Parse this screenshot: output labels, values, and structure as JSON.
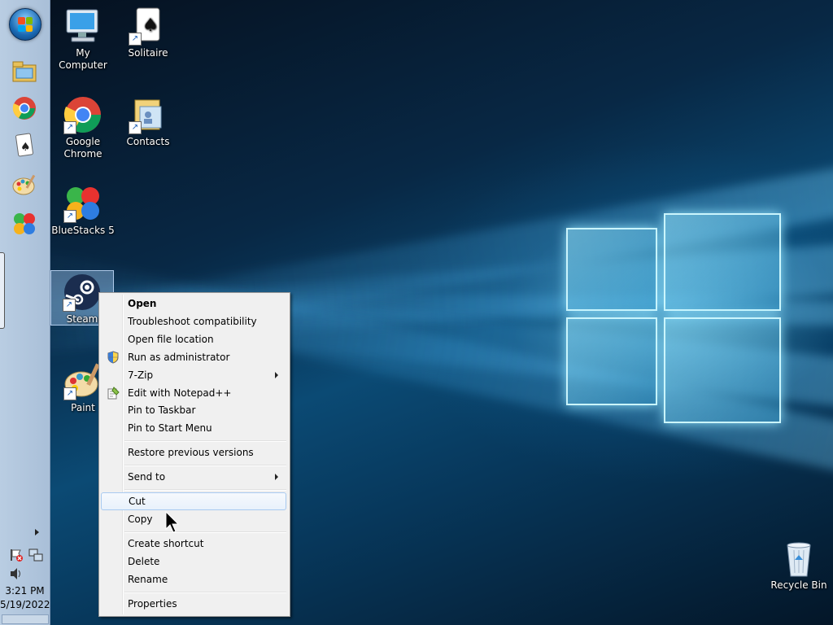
{
  "desktop": {
    "icons": [
      {
        "label": "My Computer",
        "icon": "my-computer-icon"
      },
      {
        "label": "Solitaire",
        "icon": "solitaire-icon"
      },
      {
        "label": "Google Chrome",
        "icon": "chrome-icon"
      },
      {
        "label": "Contacts",
        "icon": "contacts-icon"
      },
      {
        "label": "BlueStacks 5",
        "icon": "bluestacks-icon"
      },
      {
        "label": "Steam",
        "icon": "steam-icon",
        "selected": true
      },
      {
        "label": "Paint",
        "icon": "paint-icon"
      },
      {
        "label": "Recycle Bin",
        "icon": "recycle-bin-icon"
      }
    ]
  },
  "taskbar": {
    "pinned": [
      "start-orb-icon",
      "file-explorer-icon",
      "chrome-icon",
      "solitaire-icon",
      "paint-icon",
      "bluestacks-icon"
    ],
    "tray": {
      "time": "3:21 PM",
      "date": "5/19/2022"
    }
  },
  "context_menu": {
    "items": [
      {
        "label": "Open",
        "bold": true
      },
      {
        "label": "Troubleshoot compatibility"
      },
      {
        "label": "Open file location"
      },
      {
        "label": "Run as administrator",
        "icon": "uac-shield-icon"
      },
      {
        "label": "7-Zip",
        "submenu": true
      },
      {
        "label": "Edit with Notepad++",
        "icon": "notepad-plus-plus-icon"
      },
      {
        "label": "Pin to Taskbar"
      },
      {
        "label": "Pin to Start Menu"
      },
      {
        "label": "Restore previous versions"
      },
      {
        "label": "Send to",
        "submenu": true
      },
      {
        "label": "Cut",
        "highlighted": true
      },
      {
        "label": "Copy"
      },
      {
        "label": "Create shortcut"
      },
      {
        "label": "Delete"
      },
      {
        "label": "Rename"
      },
      {
        "label": "Properties"
      }
    ]
  },
  "colors": {
    "menu_bg": "#f0f0f0",
    "menu_hover_border": "#a8caf0",
    "taskbar": "#b9cde2"
  }
}
